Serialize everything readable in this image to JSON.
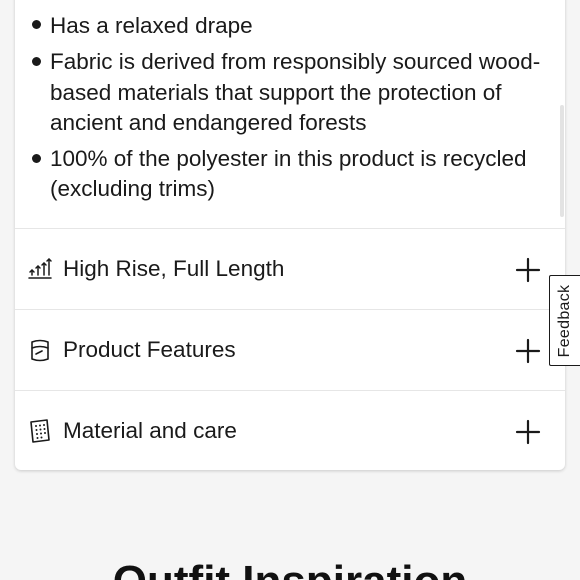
{
  "details": {
    "bullets": [
      "Has a relaxed drape",
      "Fabric is derived from responsibly sourced wood-",
      "based materials that support the protection of",
      "ancient and endangered forests",
      "100% of the polyester in this product is recycled",
      "(excluding trims)"
    ]
  },
  "accordion": [
    {
      "label": "High Rise, Full Length",
      "icon": "rise-length-icon"
    },
    {
      "label": "Product Features",
      "icon": "product-features-icon"
    },
    {
      "label": "Material and care",
      "icon": "material-care-icon"
    }
  ],
  "feedback": {
    "label": "Feedback"
  },
  "outfit": {
    "title": "Outfit Inspiration"
  }
}
